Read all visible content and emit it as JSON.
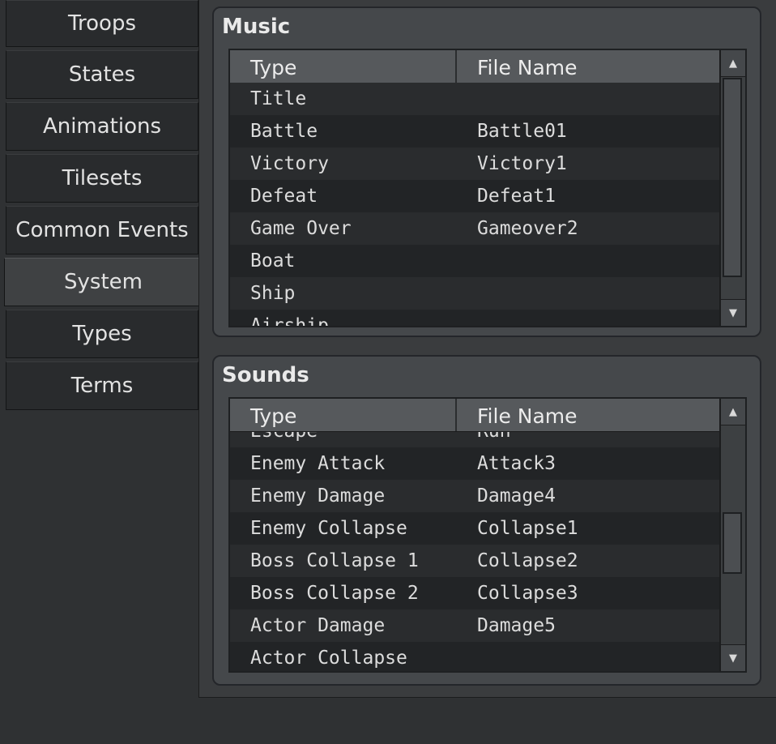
{
  "tabs": [
    {
      "label": "Troops"
    },
    {
      "label": "States"
    },
    {
      "label": "Animations"
    },
    {
      "label": "Tilesets"
    },
    {
      "label": "Common Events"
    },
    {
      "label": "System"
    },
    {
      "label": "Types"
    },
    {
      "label": "Terms"
    }
  ],
  "active_tab": "System",
  "music": {
    "title": "Music",
    "columns": {
      "type": "Type",
      "file": "File Name"
    },
    "rows": [
      {
        "type": "Title",
        "file": ""
      },
      {
        "type": "Battle",
        "file": "Battle01"
      },
      {
        "type": "Victory",
        "file": "Victory1"
      },
      {
        "type": "Defeat",
        "file": "Defeat1"
      },
      {
        "type": "Game Over",
        "file": "Gameover2"
      },
      {
        "type": "Boat",
        "file": ""
      },
      {
        "type": "Ship",
        "file": ""
      },
      {
        "type": "Airship",
        "file": ""
      }
    ]
  },
  "sounds": {
    "title": "Sounds",
    "columns": {
      "type": "Type",
      "file": "File Name"
    },
    "rows": [
      {
        "type": "Escape",
        "file": "Run"
      },
      {
        "type": "Enemy Attack",
        "file": "Attack3"
      },
      {
        "type": "Enemy Damage",
        "file": "Damage4"
      },
      {
        "type": "Enemy Collapse",
        "file": "Collapse1"
      },
      {
        "type": "Boss Collapse 1",
        "file": "Collapse2"
      },
      {
        "type": "Boss Collapse 2",
        "file": "Collapse3"
      },
      {
        "type": "Actor Damage",
        "file": "Damage5"
      },
      {
        "type": "Actor Collapse",
        "file": ""
      }
    ]
  },
  "icons": {
    "scroll_up": "▲",
    "scroll_down": "▼"
  }
}
